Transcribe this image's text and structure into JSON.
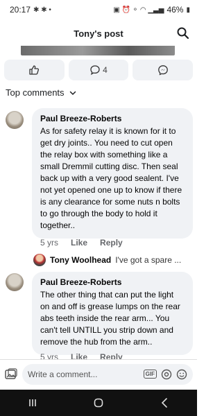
{
  "status_bar": {
    "time": "20:17",
    "battery": "46%"
  },
  "header": {
    "title": "Tony's post"
  },
  "reactions": {
    "comment_count": "4"
  },
  "top_comments": {
    "label": "Top comments"
  },
  "comments": [
    {
      "author": "Paul Breeze-Roberts",
      "text": "As for safety relay it is known for it to get dry joints.. You need to cut open the relay box with something like a small Dremmil cutting disc. Then seal back up with a very good sealent. I've not yet opened one up to know if there is any clearance for some nuts n bolts to go through the body to hold it together..",
      "time": "5 yrs",
      "like": "Like",
      "reply": "Reply"
    },
    {
      "author": "Paul Breeze-Roberts",
      "text": "The other thing that can put the light on and off is grease lumps on the rear abs teeth inside the rear arm... You can't tell UNTILL you strip down and remove the hub from the arm..",
      "time": "5 yrs",
      "like": "Like",
      "reply": "Reply"
    }
  ],
  "reply_preview": {
    "author": "Tony Woolhead",
    "text": "I've got a spare ..."
  },
  "composer": {
    "placeholder": "Write a comment...",
    "gif_label": "GIF"
  }
}
